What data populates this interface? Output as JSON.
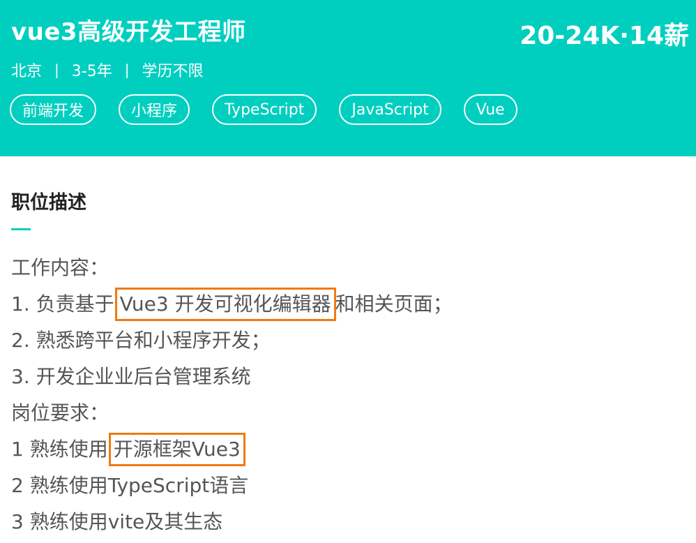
{
  "job": {
    "title": "vue3高级开发工程师",
    "salary": "20-24K·14薪",
    "meta": {
      "city": "北京",
      "experience": "3-5年",
      "education": "学历不限",
      "separator": "|"
    },
    "tags": [
      "前端开发",
      "小程序",
      "TypeScript",
      "JavaScript",
      "Vue"
    ]
  },
  "description": {
    "title": "职位描述",
    "lines": {
      "work_heading": "工作内容：",
      "w1_prefix": "1. 负责基于",
      "w1_highlight": "Vue3 开发可视化编辑器",
      "w1_suffix": "和相关页面；",
      "w2": "2. 熟悉跨平台和小程序开发；",
      "w3": "3. 开发企业业后台管理系统",
      "req_heading": "岗位要求：",
      "r1_prefix": "1 熟练使用",
      "r1_highlight": "开源框架Vue3",
      "r2": "2 熟练使用TypeScript语言",
      "r3": "3 熟练使用vite及其生态"
    }
  },
  "colors": {
    "header_bg": "#00cfc0",
    "highlight_border": "#f07a12",
    "body_text": "#555555",
    "heading_text": "#222222"
  }
}
